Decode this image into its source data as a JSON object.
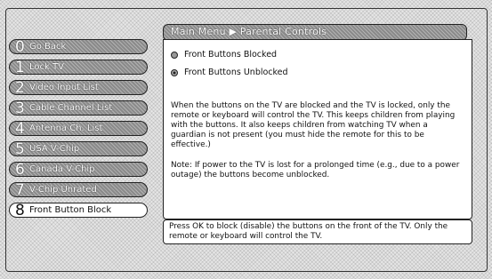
{
  "breadcrumb": "Main Menu ▶ Parental Controls",
  "menu": [
    {
      "num": "0",
      "label": "Go Back"
    },
    {
      "num": "1",
      "label": "Lock TV"
    },
    {
      "num": "2",
      "label": "Video Input List"
    },
    {
      "num": "3",
      "label": "Cable Channel List"
    },
    {
      "num": "4",
      "label": "Antenna Ch. List"
    },
    {
      "num": "5",
      "label": "USA V-Chip"
    },
    {
      "num": "6",
      "label": "Canada V-Chip"
    },
    {
      "num": "7",
      "label": "V-Chip Unrated"
    },
    {
      "num": "8",
      "label": "Front Button Block"
    }
  ],
  "selected_index": 8,
  "options": [
    {
      "label": "Front Buttons Blocked",
      "selected": false
    },
    {
      "label": "Front Buttons Unblocked",
      "selected": true
    }
  ],
  "description": "When the buttons on the TV are blocked and the TV is locked, only the remote or keyboard will control the TV. This keeps children from playing with the buttons. It also keeps children from watching TV when a guardian is not present (you must hide the remote for this to be effective.)",
  "note": "Note: If power to the TV is lost for a prolonged time (e.g., due to a power outage) the buttons become unblocked.",
  "help_text": "Press OK to block (disable) the buttons on the front of the TV. Only the remote or keyboard will control the TV."
}
